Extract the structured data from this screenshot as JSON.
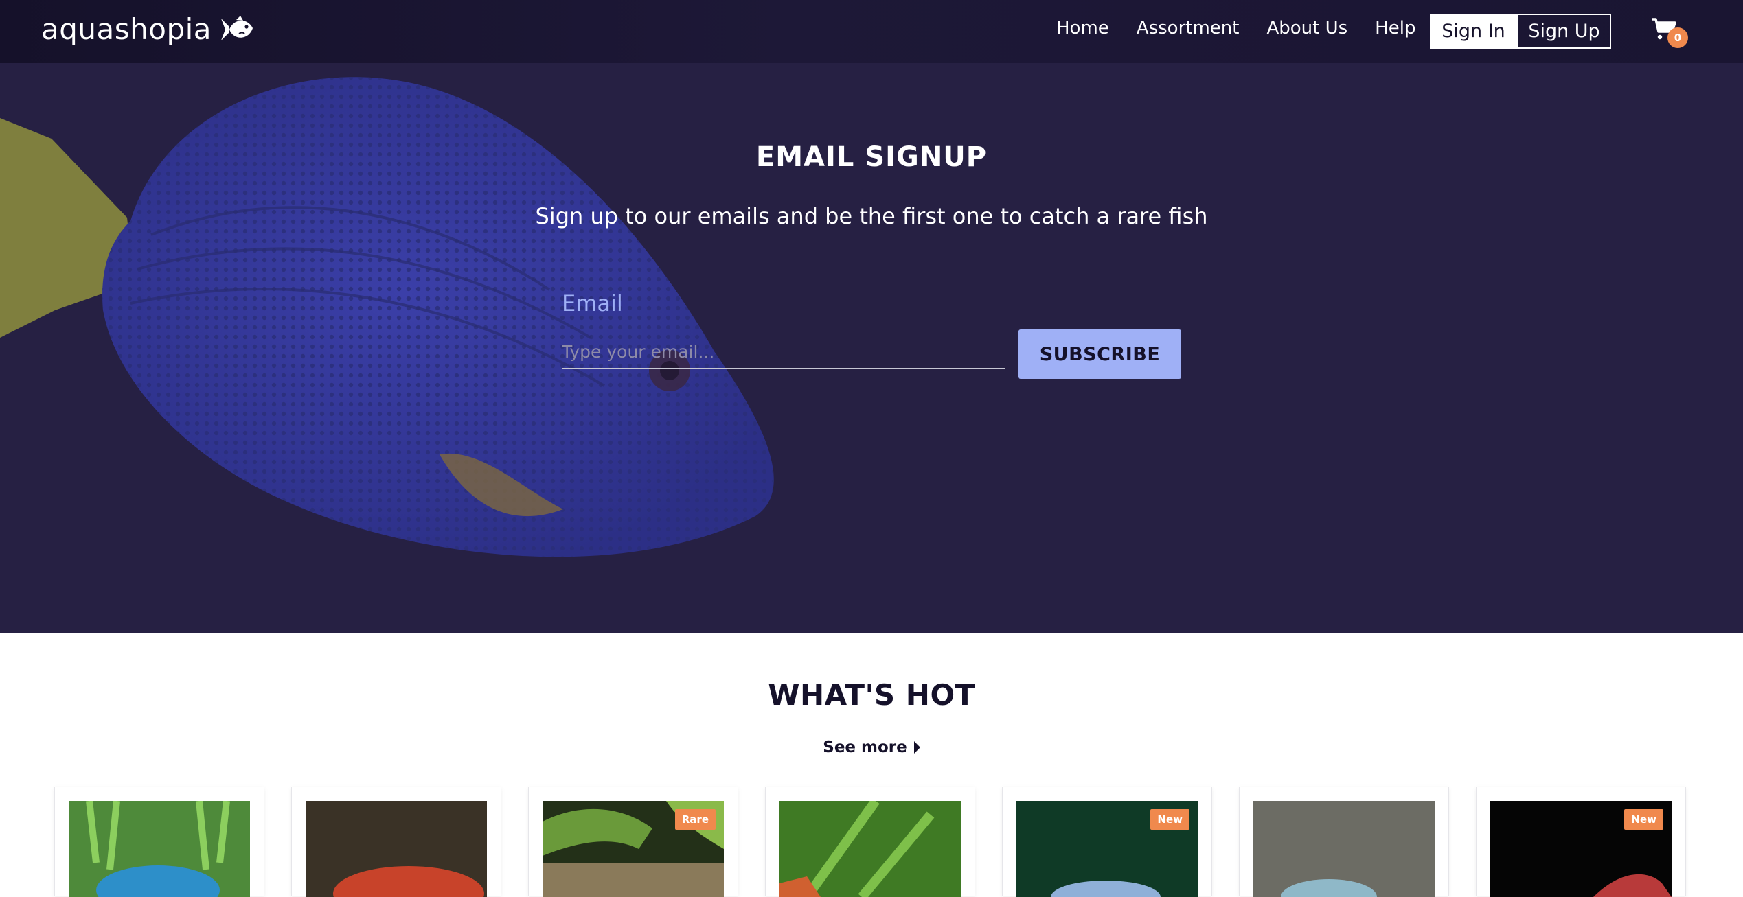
{
  "brand": {
    "name": "aquashopia",
    "icon": "fish-icon"
  },
  "nav": {
    "links": [
      "Home",
      "Assortment",
      "About Us",
      "Help"
    ],
    "sign_in": "Sign In",
    "sign_up": "Sign Up",
    "cart_icon": "cart-icon",
    "cart_count": "0"
  },
  "hero": {
    "title": "EMAIL SIGNUP",
    "subtitle": "Sign up to our emails and be the first one to catch a rare fish",
    "email_label": "Email",
    "email_placeholder": "Type your email...",
    "email_value": "",
    "subscribe_label": "SUBSCRIBE"
  },
  "hot": {
    "title": "WHAT'S HOT",
    "see_more": "See more",
    "products": [
      {
        "badge": ""
      },
      {
        "badge": ""
      },
      {
        "badge": "Rare"
      },
      {
        "badge": ""
      },
      {
        "badge": "New"
      },
      {
        "badge": ""
      },
      {
        "badge": "New"
      }
    ]
  },
  "colors": {
    "nav_bg": "#15112a",
    "hero_bg": "#262043",
    "accent": "#9fb0f6",
    "badge": "#f0894d",
    "text_dark": "#15112a"
  }
}
